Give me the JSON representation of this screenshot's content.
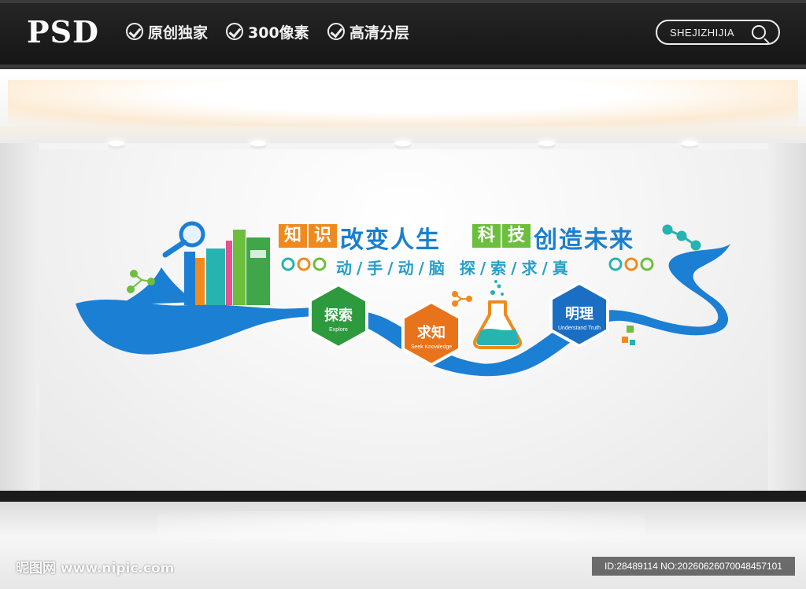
{
  "header": {
    "logo": "PSD",
    "features": [
      "原创独家",
      "300像素",
      "高清分层"
    ],
    "search_label": "SHEJIZHIJIA"
  },
  "wall": {
    "title_boxes": [
      {
        "text": "知",
        "color": "#f08a1c"
      },
      {
        "text": "识",
        "color": "#f08a1c"
      },
      {
        "text": "科",
        "color": "#6cbf3c"
      },
      {
        "text": "技",
        "color": "#6cbf3c"
      }
    ],
    "title_part1": "改变人生",
    "title_part2": "创造未来",
    "subtitle": "动/手/动/脑 探/索/求/真",
    "hexagons": [
      {
        "label": "探索",
        "sub": "Explore",
        "color": "#2e9a3e"
      },
      {
        "label": "求知",
        "sub": "Seek Knowledge",
        "color": "#e8731a"
      },
      {
        "label": "明理",
        "sub": "Understand Truth",
        "color": "#1a6fc4"
      }
    ],
    "colors": {
      "wave": "#1b7fd4",
      "accent_green": "#6cbf3c",
      "accent_orange": "#f08a1c",
      "accent_teal": "#27b3b0"
    }
  },
  "watermark": {
    "left": "昵图网 www.nipic.com",
    "right": "ID:28489114 NO:20260626070048457101"
  }
}
